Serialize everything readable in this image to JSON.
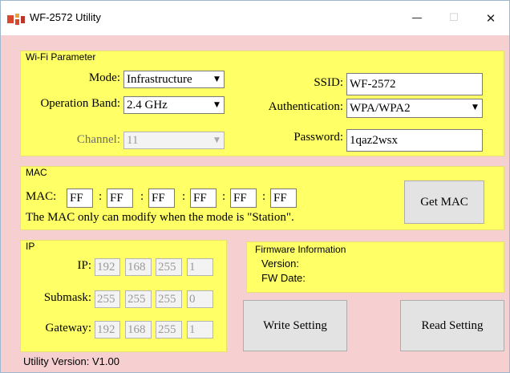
{
  "window": {
    "title": "WF-2572 Utility",
    "minimize_glyph": "—",
    "maximize_glyph": "☐",
    "close_glyph": "✕"
  },
  "wifi": {
    "group_title": "Wi-Fi Parameter",
    "mode_label": "Mode:",
    "mode_value": "Infrastructure",
    "band_label": "Operation Band:",
    "band_value": "2.4 GHz",
    "channel_label": "Channel:",
    "channel_value": "11",
    "ssid_label": "SSID:",
    "ssid_value": "WF-2572",
    "auth_label": "Authentication:",
    "auth_value": "WPA/WPA2",
    "password_label": "Password:",
    "password_value": "1qaz2wsx"
  },
  "mac": {
    "group_title": "MAC",
    "label": "MAC:",
    "octets": [
      "FF",
      "FF",
      "FF",
      "FF",
      "FF",
      "FF"
    ],
    "separator": ":",
    "note": "The MAC only can modify when the mode is \"Station\".",
    "get_mac_button": "Get MAC"
  },
  "ip": {
    "group_title": "IP",
    "ip_label": "IP:",
    "ip_octets": [
      "192",
      "168",
      "255",
      "1"
    ],
    "submask_label": "Submask:",
    "submask_octets": [
      "255",
      "255",
      "255",
      "0"
    ],
    "gateway_label": "Gateway:",
    "gateway_octets": [
      "192",
      "168",
      "255",
      "1"
    ]
  },
  "firmware": {
    "group_title": "Firmware Information",
    "version_label": "Version:",
    "fw_date_label": "FW Date:"
  },
  "actions": {
    "write_button": "Write Setting",
    "read_button": "Read Setting"
  },
  "footer": {
    "utility_version": "Utility Version: V1.00"
  },
  "colors": {
    "panel_background": "#f6d0d0",
    "group_background": "#ffff66"
  }
}
